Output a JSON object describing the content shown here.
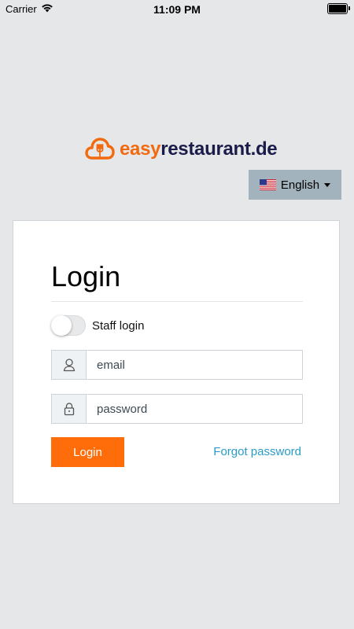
{
  "status_bar": {
    "carrier": "Carrier",
    "time": "11:09 PM"
  },
  "logo": {
    "part1": "easy",
    "part2": "restaurant.de",
    "brand_color": "#f26a10",
    "dark_color": "#1c1c4a"
  },
  "language": {
    "selected": "English",
    "flag": "us-flag-icon"
  },
  "login": {
    "title": "Login",
    "staff_toggle_label": "Staff login",
    "staff_toggle_on": false,
    "email_placeholder": "email",
    "password_placeholder": "password",
    "submit_label": "Login",
    "forgot_label": "Forgot password",
    "accent_color": "#ff6d0a",
    "link_color": "#2a9bc9"
  }
}
